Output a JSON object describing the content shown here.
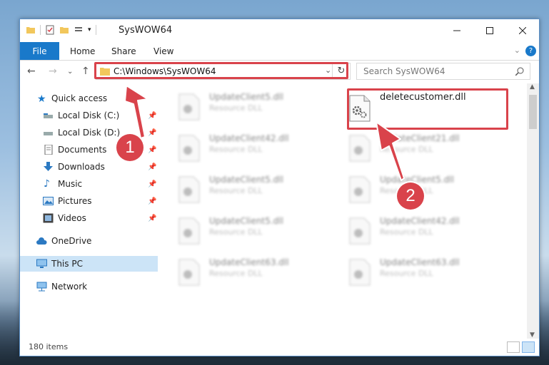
{
  "window": {
    "title": "SysWOW64"
  },
  "ribbon": {
    "tabs": [
      "File",
      "Home",
      "Share",
      "View"
    ]
  },
  "address": {
    "path": "C:\\Windows\\SysWOW64",
    "search_placeholder": "Search SysWOW64"
  },
  "sidebar": {
    "items": [
      {
        "label": "Quick access",
        "icon": "star-icon"
      },
      {
        "label": "Local Disk (C:)",
        "icon": "drive-icon"
      },
      {
        "label": "Local Disk (D:)",
        "icon": "drive-icon"
      },
      {
        "label": "Documents",
        "icon": "documents-icon"
      },
      {
        "label": "Downloads",
        "icon": "download-icon"
      },
      {
        "label": "Music",
        "icon": "music-icon"
      },
      {
        "label": "Pictures",
        "icon": "pictures-icon"
      },
      {
        "label": "Videos",
        "icon": "videos-icon"
      },
      {
        "label": "OneDrive",
        "icon": "cloud-icon"
      },
      {
        "label": "This PC",
        "icon": "monitor-icon"
      },
      {
        "label": "Network",
        "icon": "network-icon"
      }
    ]
  },
  "files": [
    {
      "name": "UpdateClient5.dll",
      "type": "Resource DLL"
    },
    {
      "name": "deletecustomer.dll",
      "type": ""
    },
    {
      "name": "UpdateClient42.dll",
      "type": "Resource DLL"
    },
    {
      "name": "UpdateClient21.dll",
      "type": "Resource DLL"
    },
    {
      "name": "UpdateClient5.dll",
      "type": "Resource DLL"
    },
    {
      "name": "UpdateClient5.dll",
      "type": "Resource DLL"
    },
    {
      "name": "UpdateClient5.dll",
      "type": "Resource DLL"
    },
    {
      "name": "UpdateClient42.dll",
      "type": "Resource DLL"
    },
    {
      "name": "UpdateClient63.dll",
      "type": "Resource DLL"
    },
    {
      "name": "UpdateClient63.dll",
      "type": "Resource DLL"
    }
  ],
  "status": {
    "items": "180 items"
  },
  "annotations": {
    "step1": "1",
    "step2": "2"
  },
  "colors": {
    "accent": "#1979ca",
    "highlight": "#d9434b"
  }
}
